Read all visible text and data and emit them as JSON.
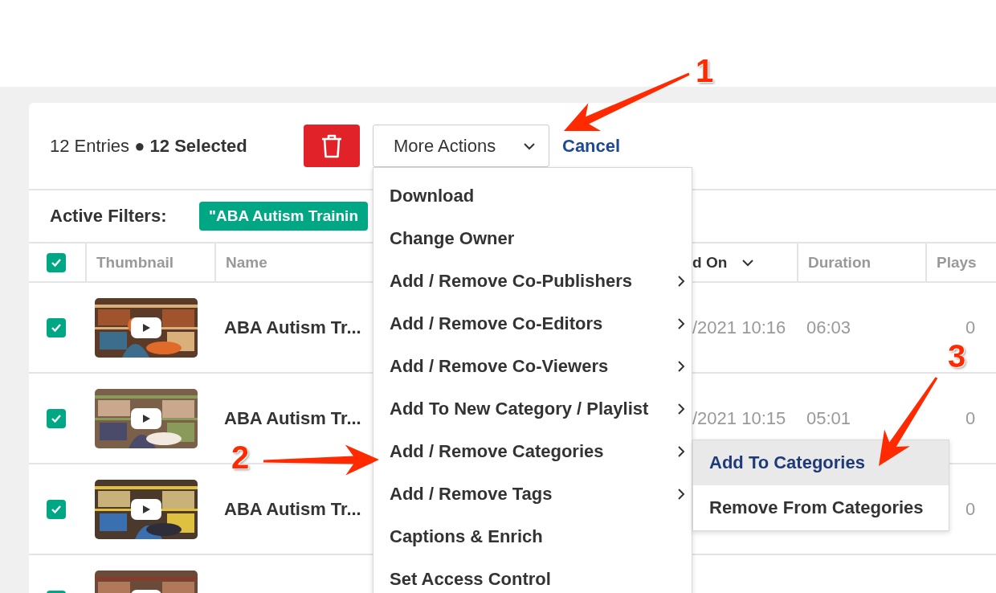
{
  "toolbar": {
    "summary": "12 Entries ● **12 Selected**",
    "more_actions": "More Actions",
    "cancel": "Cancel"
  },
  "filters": {
    "label": "Active Filters:",
    "chips": [
      "\"ABA Autism Trainin"
    ]
  },
  "table": {
    "select_all": {
      "checked": true
    },
    "columns": [
      "Thumbnail",
      "Name",
      "d On",
      "Duration",
      "Plays"
    ],
    "rows": [
      {
        "checked": true,
        "name": "ABA Autism Tr...",
        "date": "/2021 10:16",
        "duration": "06:03",
        "plays": "0"
      },
      {
        "checked": true,
        "name": "ABA Autism Tr...",
        "date": "/2021 10:15",
        "duration": "05:01",
        "plays": "0"
      },
      {
        "checked": true,
        "name": "ABA Autism Tr...",
        "plays": "0"
      },
      {
        "checked": true
      }
    ]
  },
  "menu": {
    "items": [
      {
        "label": "Download",
        "has_submenu": false
      },
      {
        "label": "Change Owner",
        "has_submenu": false
      },
      {
        "label": "Add / Remove Co-Publishers",
        "has_submenu": true
      },
      {
        "label": "Add / Remove Co-Editors",
        "has_submenu": true
      },
      {
        "label": "Add / Remove Co-Viewers",
        "has_submenu": true
      },
      {
        "label": "Add To New Category / Playlist",
        "has_submenu": true
      },
      {
        "label": "Add / Remove Categories",
        "has_submenu": true,
        "submenu": [
          {
            "label": "Add To Categories",
            "selected": true
          },
          {
            "label": "Remove From Categories",
            "selected": false
          }
        ]
      },
      {
        "label": "Add / Remove Tags",
        "has_submenu": true
      },
      {
        "label": "Captions & Enrich",
        "has_submenu": false
      },
      {
        "label": "Set Access Control",
        "has_submenu": false
      }
    ]
  },
  "annotations": [
    {
      "label": "1"
    },
    {
      "label": "2"
    },
    {
      "label": "3"
    }
  ]
}
